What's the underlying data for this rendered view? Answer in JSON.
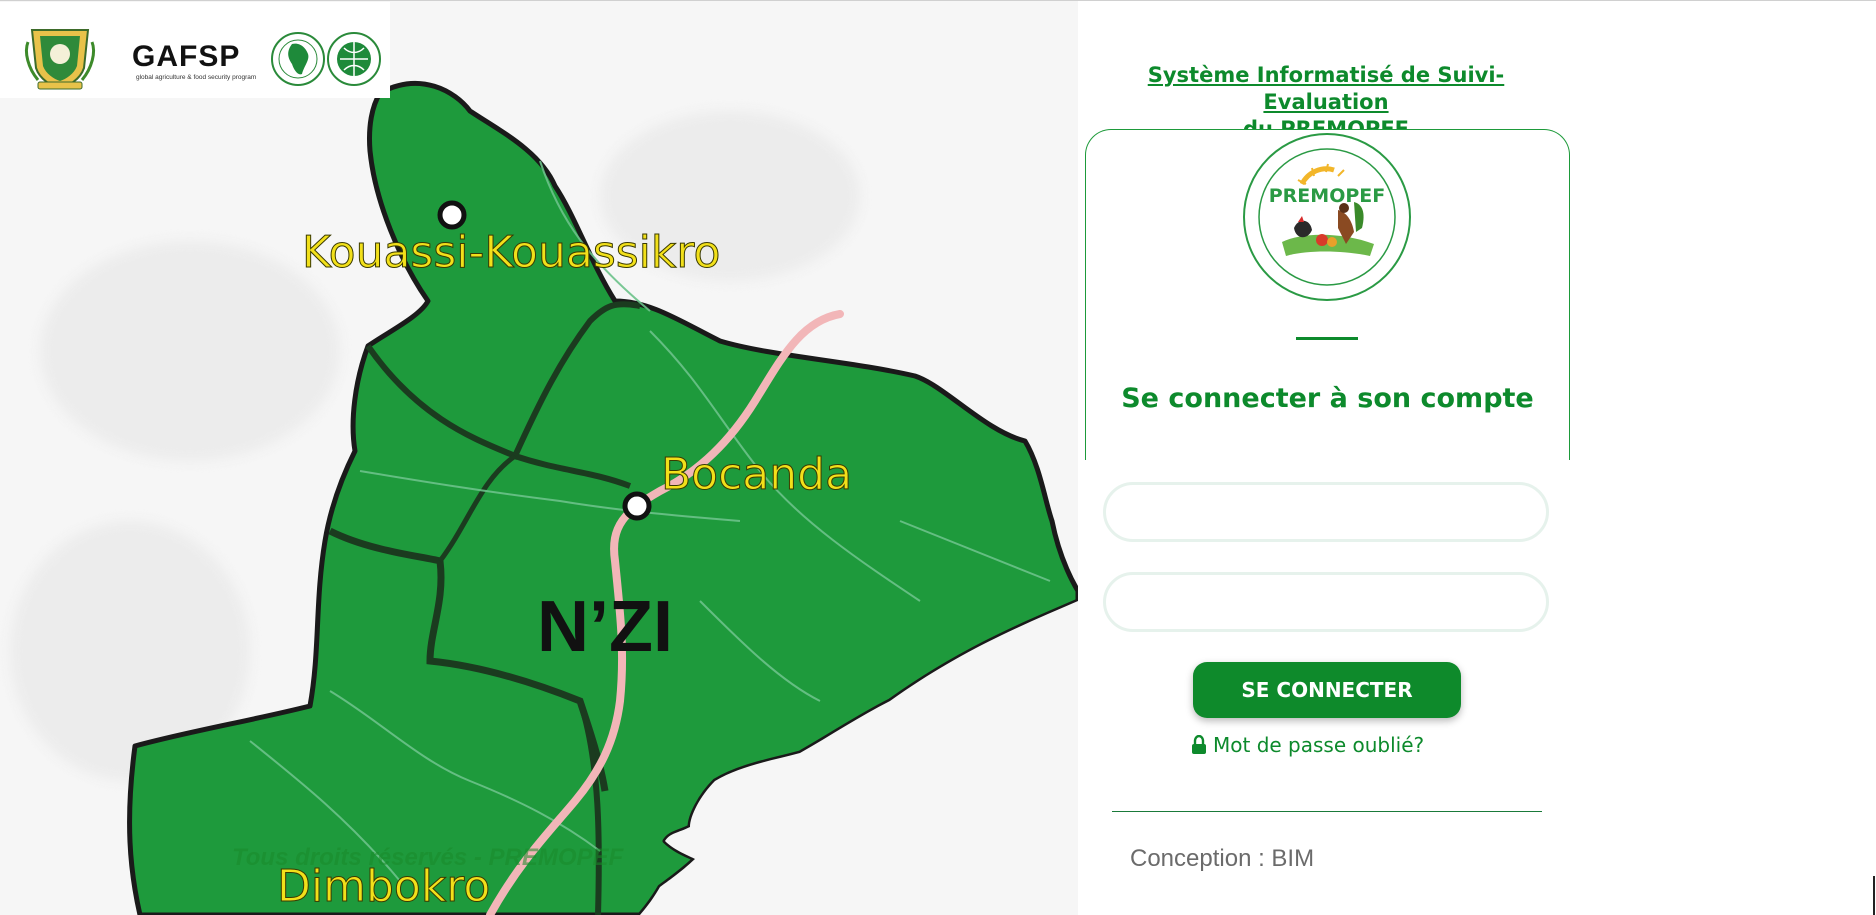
{
  "header": {
    "title_line1": "Système Informatisé de Suivi-Evaluation",
    "title_line2": "du PREMOPEF",
    "partner_logo_text": "GAFSP",
    "partner_logo_subtitle": "global agriculture & food security program"
  },
  "map": {
    "region_name": "N’ZI",
    "towns": [
      "Kouassi-Kouassikro",
      "Bocanda",
      "Dimbokro"
    ],
    "region_color": "#1e9a3c",
    "road_color": "#f2b6b8",
    "town_label_color": "#f2e01a"
  },
  "login": {
    "project_logo_text": "PREMOPEF",
    "heading": "Se connecter à son compte",
    "username_placeholder": "",
    "password_placeholder": "",
    "submit_label": "SE CONNECTER",
    "forgot_label": "Mot de passe oublié?",
    "accent_color": "#0d8a2c"
  },
  "footer": {
    "rights": "Tous droits réservés - PREMOPEF",
    "credit": "Conception : BIM"
  }
}
